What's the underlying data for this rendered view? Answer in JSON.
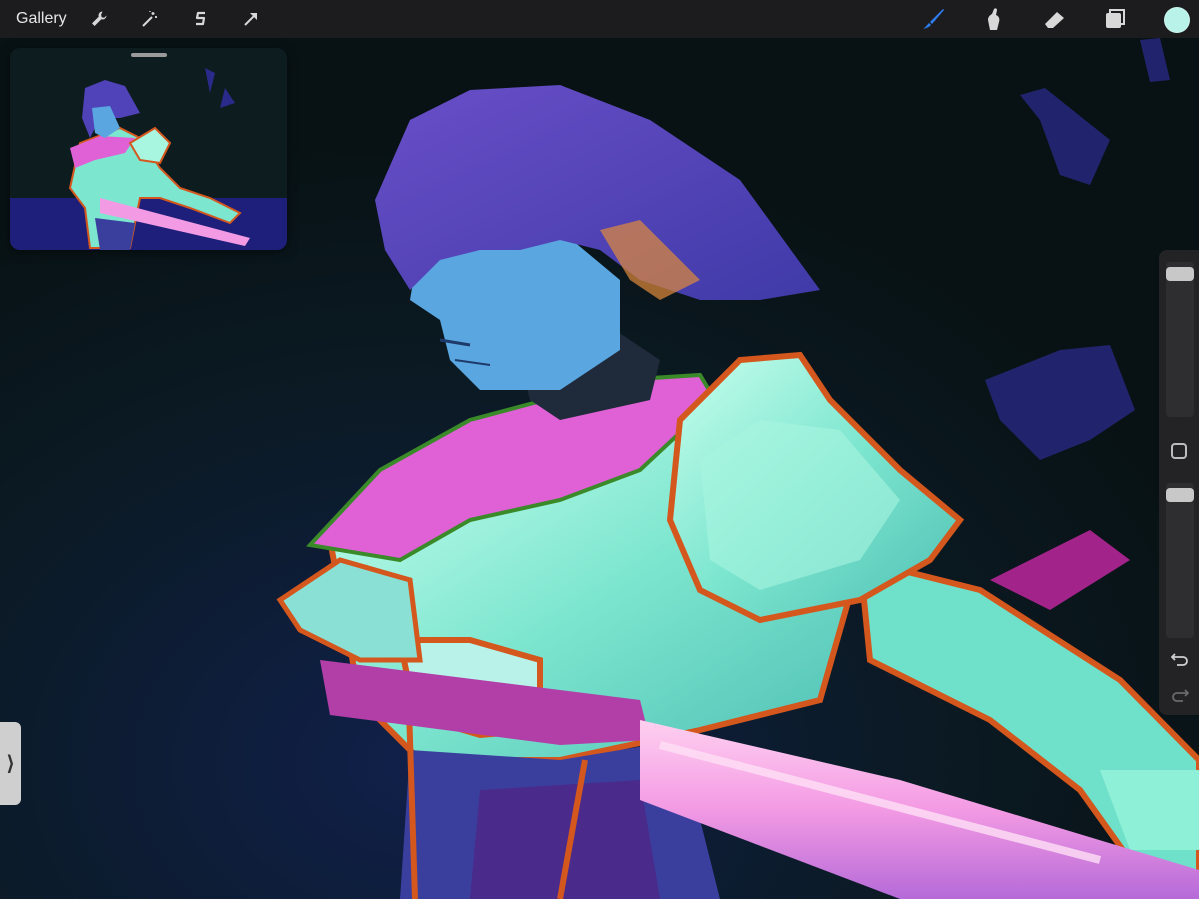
{
  "topbar": {
    "gallery_label": "Gallery",
    "left_tools": [
      "wrench-icon",
      "magic-wand-icon",
      "selection-s-icon",
      "transform-arrow-icon"
    ],
    "right_tools": [
      "brush-icon",
      "smudge-icon",
      "eraser-icon",
      "layers-icon"
    ],
    "active_tool": "brush-icon",
    "accent_color": "#2f7df6",
    "current_color": "#b9f2e8"
  },
  "reference": {
    "content": "reference-thumbnail"
  },
  "sidebar": {
    "brush_size_value": 0.07,
    "opacity_value": 0.06,
    "icons": [
      "modify-square-icon",
      "undo-icon",
      "redo-icon"
    ]
  },
  "left_tab": {
    "glyph": "⟩"
  },
  "canvas": {
    "background_color": "#0b1618"
  }
}
